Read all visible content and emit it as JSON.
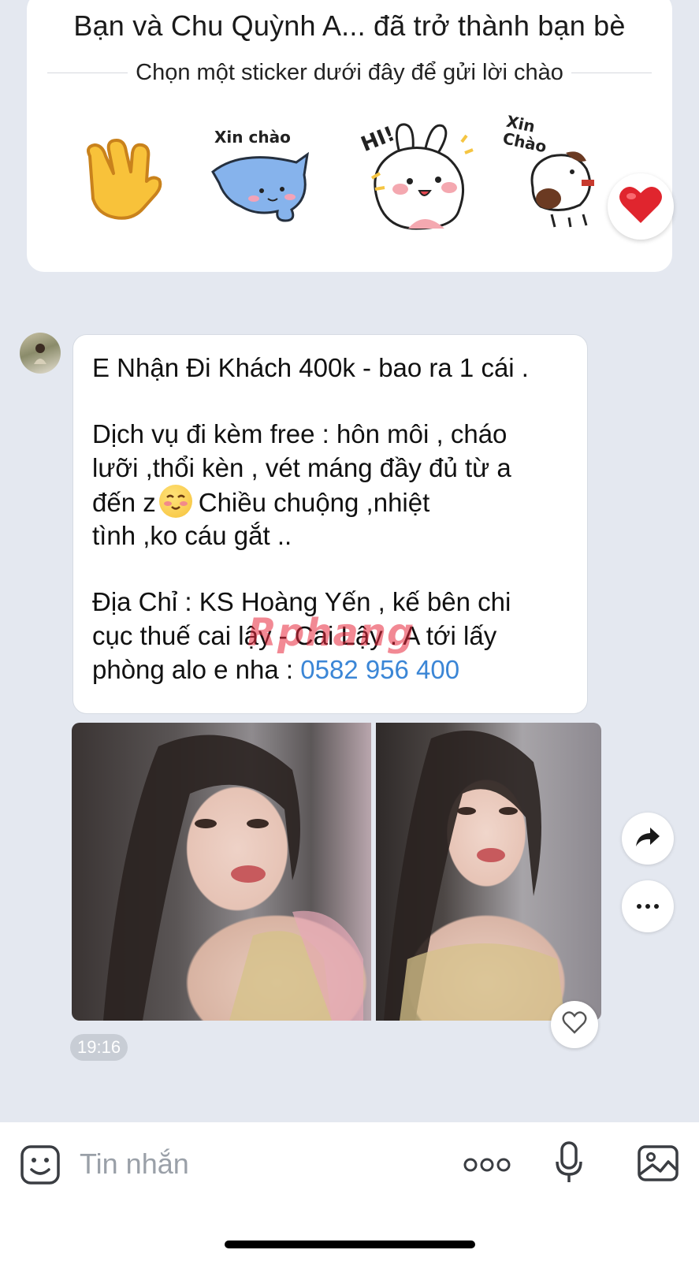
{
  "friend_banner": {
    "title": "Bạn và Chu Quỳnh A...  đã trở thành bạn bè",
    "subtitle": "Chọn một sticker dưới đây để gửi lời chào",
    "stickers": [
      {
        "icon": "waving-hand-icon",
        "caption": ""
      },
      {
        "icon": "blue-cat-sticker-icon",
        "caption": "Xin chào"
      },
      {
        "icon": "bunny-sticker-icon",
        "caption": "HI!"
      },
      {
        "icon": "dog-sticker-icon",
        "caption": "Xin\nChào"
      }
    ]
  },
  "message": {
    "lines": [
      "E Nhận Đi Khách 400k - bao ra 1 cái .",
      "",
      "Dịch vụ đi kèm free : hôn môi , cháo",
      "lưỡi ,thổi kèn , vét máng đầy đủ từ a",
      "đến z",
      "Chiều chuộng ,nhiệt",
      "tình ,ko cáu gắt ..",
      "",
      "Địa Chỉ : KS Hoàng Yến , kế bên chi",
      "cục thuế cai lậy - Cai Lậy . A tới lấy",
      "phòng alo e nha : "
    ],
    "phone": "0582 956 400",
    "watermark": "Rphang",
    "time": "19:16"
  },
  "input_bar": {
    "placeholder": "Tin nhắn",
    "icons": [
      "emoji-icon",
      "more-icon",
      "microphone-icon",
      "image-icon"
    ]
  },
  "colors": {
    "background": "#e4e8f0",
    "link": "#3b86d6",
    "heart": "#e0252e"
  }
}
